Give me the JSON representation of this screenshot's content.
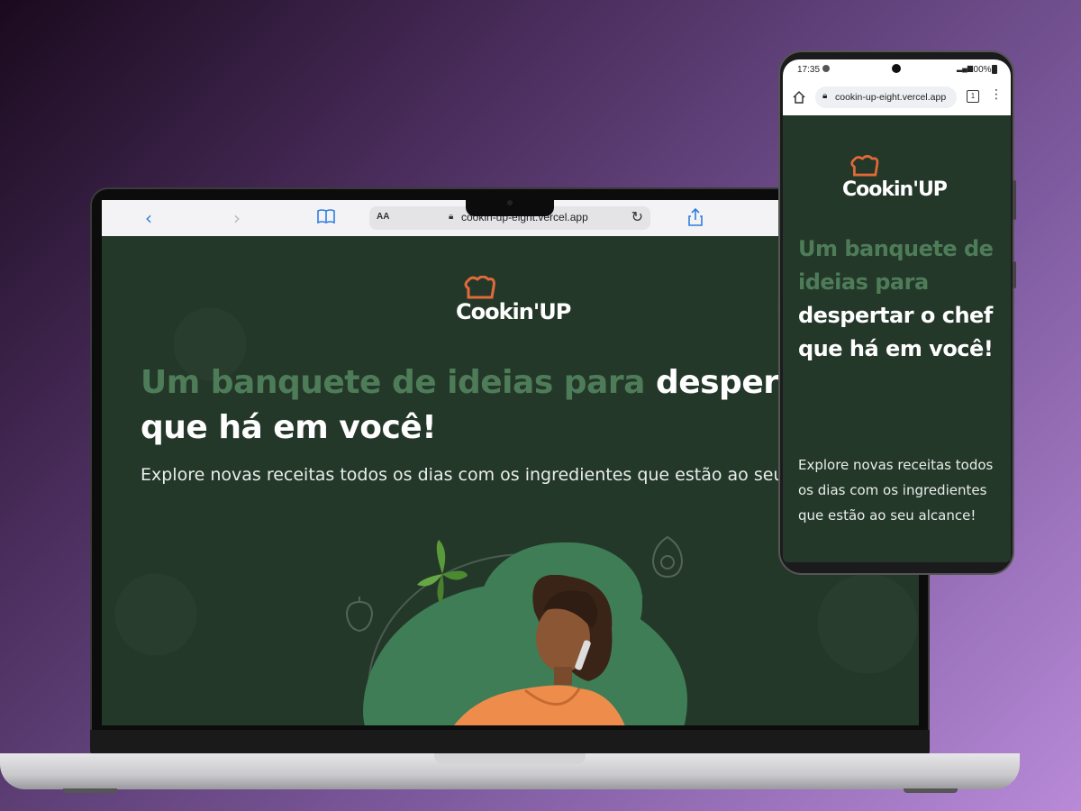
{
  "laptop": {
    "browser": {
      "url": "cookin-up-eight.vercel.app",
      "reader_label": "AA"
    }
  },
  "phone": {
    "status": {
      "time": "17:35",
      "signal": "▂▄▆",
      "battery": "100%"
    },
    "browser": {
      "url": "cookin-up-eight.vercel.app",
      "tab_count": "1"
    }
  },
  "site": {
    "logo": "Cookin'UP",
    "hero_title_muted": "Um banquete de ideias para",
    "hero_title_bold": "despertar o chef que há em você!",
    "hero_subtitle": "Explore novas receitas todos os dias com os ingredientes que estão ao seu alcance!"
  },
  "colors": {
    "page_bg": "#24382a",
    "title_muted": "#4e7c58",
    "accent_orange": "#e26a38",
    "blob_green": "#3f7d56"
  },
  "icons": {
    "laptop_toolbar": [
      "back-arrow-icon",
      "forward-arrow-icon",
      "bookmarks-icon",
      "lock-icon",
      "reload-icon",
      "share-icon"
    ],
    "phone_toolbar": [
      "home-icon",
      "lock-icon",
      "tabs-icon",
      "more-menu-icon"
    ]
  }
}
